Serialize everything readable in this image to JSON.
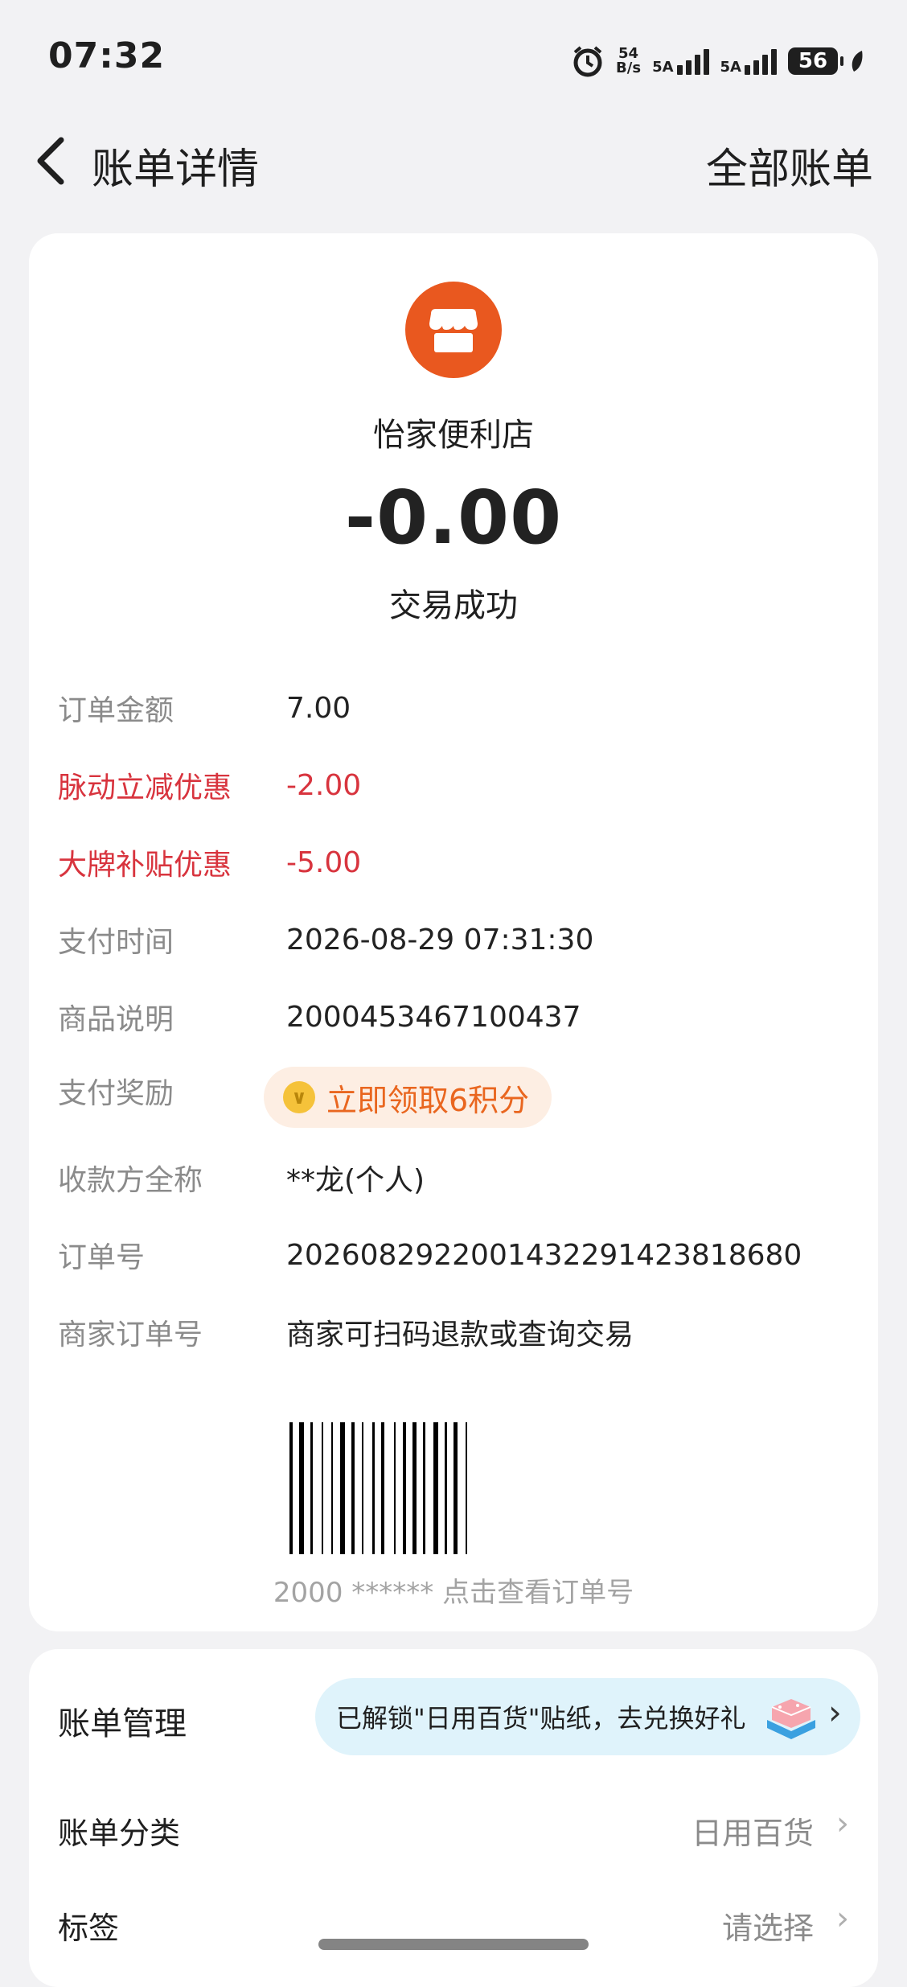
{
  "status_bar": {
    "time": "07:32",
    "net_speed_top": "54",
    "net_speed_bottom": "B/s",
    "sim1": "5A",
    "sim2": "5A",
    "battery": "56"
  },
  "nav": {
    "title": "账单详情",
    "right_link": "全部账单"
  },
  "merchant": {
    "name": "怡家便利店",
    "amount": "-0.00",
    "status": "交易成功",
    "icon_color": "#e9581f"
  },
  "details": {
    "order_amount_label": "订单金额",
    "order_amount_value": "7.00",
    "discount1_label": "脉动立减优惠",
    "discount1_value": "-2.00",
    "discount2_label": "大牌补贴优惠",
    "discount2_value": "-5.00",
    "pay_time_label": "支付时间",
    "pay_time_value": "2026-08-29 07:31:30",
    "goods_label": "商品说明",
    "goods_value": "2000453467100437",
    "reward_label": "支付奖励",
    "reward_button": "立即领取6积分",
    "payee_label": "收款方全称",
    "payee_value": "**龙(个人)",
    "order_no_label": "订单号",
    "order_no_value": "2026082922001432291423818680",
    "merchant_order_label": "商家订单号",
    "merchant_order_value": "商家可扫码退款或查询交易"
  },
  "barcode": {
    "caption": "2000 ****** 点击查看订单号"
  },
  "management": {
    "title": "账单管理",
    "promo_text": "已解锁\"日用百货\"贴纸，去兑换好礼",
    "category_label": "账单分类",
    "category_value": "日用百货",
    "tag_label": "标签",
    "tag_value": "请选择"
  },
  "colors": {
    "accent_red": "#d8343e",
    "reward_orange": "#e9661f",
    "promo_bg": "#dff3fb"
  }
}
